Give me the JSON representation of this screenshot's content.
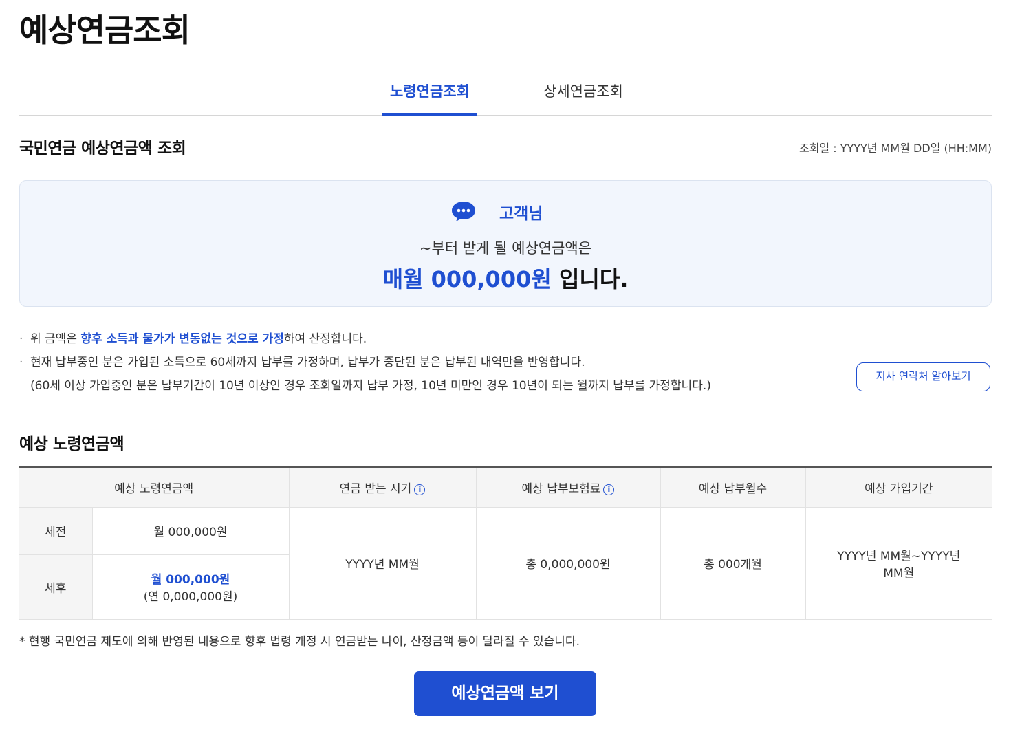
{
  "page_title": "예상연금조회",
  "tabs": [
    {
      "label": "노령연금조회",
      "active": true
    },
    {
      "label": "상세연금조회",
      "active": false
    }
  ],
  "summary_section": {
    "title": "국민연금 예상연금액 조회",
    "query_date": "조회일 : YYYY년 MM월 DD일 (HH:MM)"
  },
  "summary_box": {
    "customer": "고객님",
    "line": "~부터 받게 될 예상연금액은",
    "amount_accent": "매월 000,000원",
    "amount_suffix": " 입니다."
  },
  "notes": {
    "n1_pre": "위 금액은 ",
    "n1_highlight": "향후 소득과 물가가 변동없는 것으로 가정",
    "n1_post": "하여 산정합니다.",
    "n2": "현재 납부중인 분은 가입된 소득으로 60세까지 납부를 가정하며, 납부가 중단된 분은 납부된 내역만을 반영합니다.",
    "n3": "(60세 이상 가입중인 분은 납부기간이 10년 이상인 경우 조회일까지 납부 가정, 10년 미만인 경우 10년이 되는 월까지 납부를 가정합니다.)"
  },
  "branch_button": "지사 연락처 알아보기",
  "table_section_title": "예상 노령연금액",
  "table": {
    "headers": [
      "예상 노령연금액",
      "연금 받는 시기",
      "예상 납부보험료",
      "예상 납부월수",
      "예상 가입기간"
    ],
    "info_icon": "i",
    "pre_tax_label": "세전",
    "pre_tax_amount": "월 000,000원",
    "after_tax_label": "세후",
    "after_tax_amount": "월 000,000원",
    "after_tax_yearly": "(연 0,000,000원)",
    "start_time": "YYYY년 MM월",
    "premium": "총 0,000,000원",
    "months": "총 000개월",
    "period_line1": "YYYY년 MM월~YYYY년",
    "period_line2": "MM월"
  },
  "footnote": "* 현행 국민연금 제도에 의해 반영된 내용으로 향후 법령 개정 시 연금받는 나이, 산정금액 등이 달라질 수 있습니다.",
  "cta_button": "예상연금액 보기",
  "colors": {
    "accent": "#1f4fd1",
    "summary_bg": "#f2f6fd"
  },
  "icons": {
    "chat": "chat-bubble-icon",
    "info": "info-icon"
  }
}
